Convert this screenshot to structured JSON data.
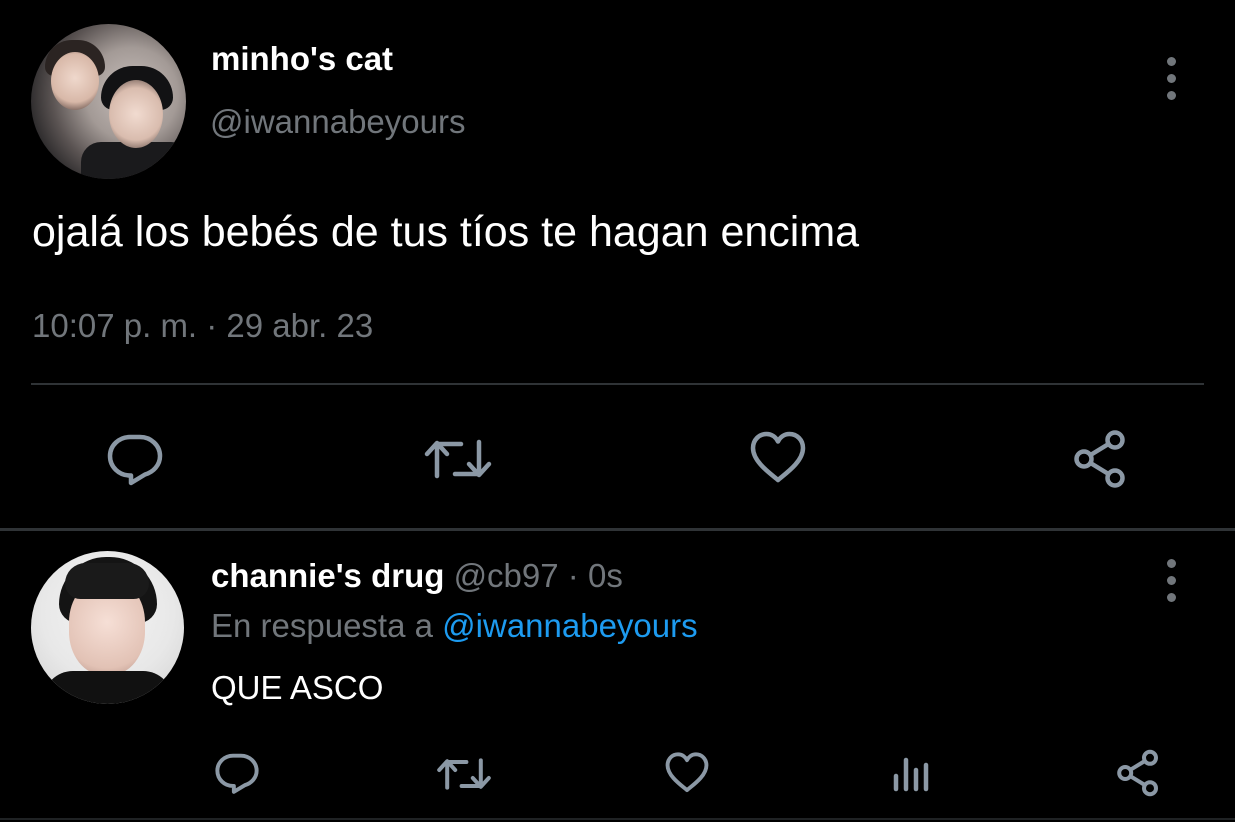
{
  "main_tweet": {
    "display_name": "minho's cat",
    "handle": "@iwannabeyours",
    "text": "ojalá los bebés de tus tíos te hagan encima",
    "timestamp": "10:07 p. m. · 29 abr. 23",
    "actions": [
      {
        "icon": "reply-icon"
      },
      {
        "icon": "retweet-icon"
      },
      {
        "icon": "like-icon"
      },
      {
        "icon": "share-icon"
      }
    ]
  },
  "reply_tweet": {
    "display_name": "channie's drug",
    "handle": "@cb97",
    "separator": "·",
    "age": "0s",
    "reply_prefix": "En respuesta a",
    "reply_mention": "@iwannabeyours",
    "text": "QUE ASCO",
    "actions": [
      {
        "icon": "reply-icon"
      },
      {
        "icon": "retweet-icon"
      },
      {
        "icon": "like-icon"
      },
      {
        "icon": "analytics-icon"
      },
      {
        "icon": "share-icon"
      }
    ]
  },
  "colors": {
    "background": "#000000",
    "primary_text": "#ffffff",
    "secondary_text": "#71767b",
    "link": "#1d9bf0",
    "divider": "#2f3336",
    "icon": "#8b98a5"
  }
}
